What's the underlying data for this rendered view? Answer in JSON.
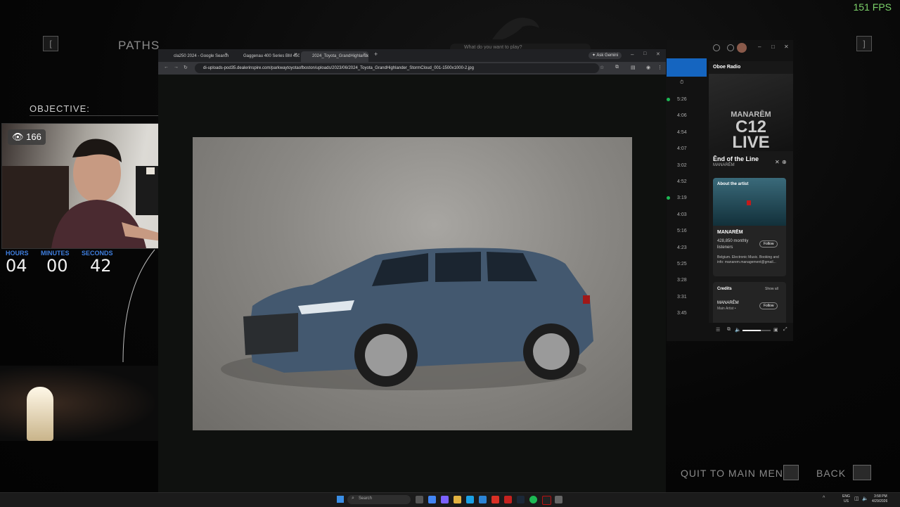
{
  "game": {
    "fps": "151 FPS",
    "title": "PATHS",
    "left_bracket": "[",
    "right_bracket": "]",
    "objective_label": "OBJECTIVE:",
    "timer": {
      "hours_label": "HOURS",
      "minutes_label": "MINUTES",
      "seconds_label": "SECONDS",
      "hours": "04",
      "minutes": "00",
      "seconds": "42"
    },
    "quit_label": "QUIT TO MAIN MENU",
    "back_label": "BACK",
    "steam_search_placeholder": "What do you want to play?"
  },
  "webcam": {
    "viewers": "166"
  },
  "browser": {
    "tabs": [
      {
        "title": "cla250 2024 - Google Search"
      },
      {
        "title": "Gaggenau 400 Series BM 450..."
      },
      {
        "title": "2024_Toyota_GrandHighlander..."
      }
    ],
    "ask_gemini": "Ask Gemini",
    "url": "di-uploads-pod35.dealerinspire.com/parkwaytoyotaofboston/uploads/2023/06/2024_Toyota_GrandHighlander_StormCloud_001-1500x1000-2.jpg"
  },
  "spotify": {
    "track_times": [
      "5:26",
      "4:06",
      "4:54",
      "4:07",
      "3:02",
      "4:52",
      "3:19",
      "4:03",
      "5:16",
      "4:23",
      "5:25",
      "3:28",
      "3:31",
      "3:45"
    ],
    "panel_title": "Oboe Radio",
    "cover_line1": "MANARĒM",
    "cover_line2": "C12",
    "cover_line3": "LIVE",
    "track_title": "Ēnd of the Line",
    "track_artist": "MANARĒM",
    "about_title": "About the artist",
    "artist_name": "MANARĒM",
    "monthly_listeners": "428,850 monthly listeners",
    "follow_label": "Follow",
    "artist_bio": "Belgium. Electronic Music. Booking and info: manarem.management@gmail...",
    "credits_title": "Credits",
    "show_all": "Show all",
    "credit_name": "MANARĒM",
    "credit_role": "Main Artist •"
  },
  "taskbar": {
    "search_placeholder": "Search",
    "lang": "ENG",
    "region": "US",
    "time": "3:58 PM",
    "date": "4/29/2026"
  },
  "colors": {
    "accent_blue": "#3f7fe0",
    "fps_green": "#7cd26a",
    "spotify_green": "#1db954"
  }
}
